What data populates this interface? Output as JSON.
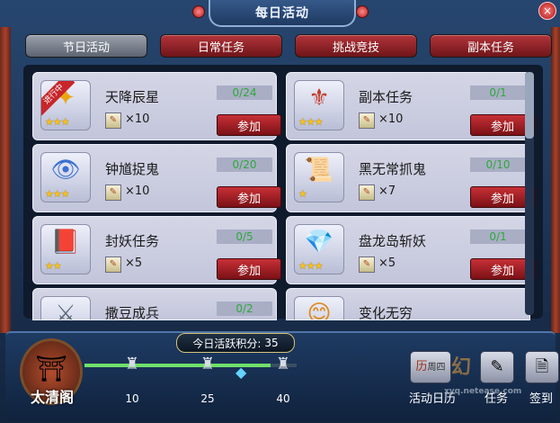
{
  "header": {
    "title": "每日活动",
    "close_glyph": "×"
  },
  "tabs": [
    {
      "label": "节日活动",
      "style": "gray"
    },
    {
      "label": "日常任务",
      "style": "red"
    },
    {
      "label": "挑战竞技",
      "style": "red"
    },
    {
      "label": "副本任务",
      "style": "red"
    }
  ],
  "activities": [
    {
      "name": "天降辰星",
      "progress": "0/24",
      "reward_count": "×10",
      "join_label": "参加",
      "stars": "★★★",
      "ribbon": "进行中",
      "icon": "star-scroll-icon",
      "glyph": "✦"
    },
    {
      "name": "副本任务",
      "progress": "0/1",
      "reward_count": "×10",
      "join_label": "参加",
      "stars": "★★★",
      "icon": "dungeon-emblem-icon",
      "glyph": "⚜"
    },
    {
      "name": "钟馗捉鬼",
      "progress": "0/20",
      "reward_count": "×10",
      "join_label": "参加",
      "stars": "★★★",
      "icon": "ghost-mask-icon",
      "glyph": "👁"
    },
    {
      "name": "黑无常抓鬼",
      "progress": "0/10",
      "reward_count": "×7",
      "join_label": "参加",
      "stars": "★",
      "icon": "ghost-book-icon",
      "glyph": "📜"
    },
    {
      "name": "封妖任务",
      "progress": "0/5",
      "reward_count": "×5",
      "join_label": "参加",
      "stars": "★★",
      "icon": "spell-book-icon",
      "glyph": "📕"
    },
    {
      "name": "盘龙岛斩妖",
      "progress": "0/1",
      "reward_count": "×5",
      "join_label": "参加",
      "stars": "★★★",
      "icon": "treasure-chest-icon",
      "glyph": "💎"
    },
    {
      "name": "撒豆成兵",
      "progress": "0/2",
      "glyph": "⚔",
      "icon": "soldier-icon"
    },
    {
      "name": "变化无穷",
      "glyph": "😊",
      "icon": "transform-face-icon"
    }
  ],
  "bottom": {
    "pavilion_label": "太清阁",
    "score_label": "今日活跃积分:",
    "score_value": "35",
    "score_progress_fraction": 0.875,
    "milestones": [
      "10",
      "25",
      "40"
    ],
    "buttons": [
      {
        "label": "活动日历",
        "icon": "calendar-icon",
        "glyph": "历"
      },
      {
        "label": "任务",
        "icon": "quest-icon",
        "glyph": "✎"
      },
      {
        "label": "签到",
        "icon": "signin-icon",
        "glyph": "🗎"
      }
    ],
    "calendar_badge": "周四"
  },
  "watermark": {
    "brand": "梦幻",
    "url": "xyq.netease.com"
  },
  "colors": {
    "progress_text": "#2fa83a",
    "join_button": "#b3343a",
    "tab_active_bg": "#b3343a",
    "score_fill": "#6fe06a"
  }
}
